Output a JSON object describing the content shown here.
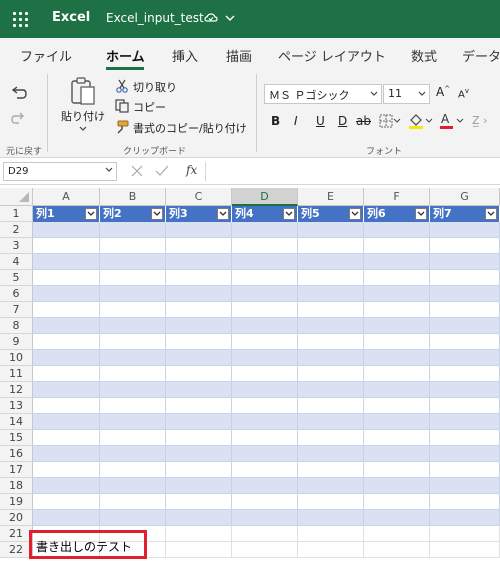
{
  "titlebar": {
    "app": "Excel",
    "document": "Excel_input_test"
  },
  "tabs": [
    "ファイル",
    "ホーム",
    "挿入",
    "描画",
    "ページ レイアウト",
    "数式",
    "データ"
  ],
  "ribbon": {
    "undo_label": "元に戻す",
    "paste_label": "貼り付け",
    "cut_label": "切り取り",
    "copy_label": "コピー",
    "format_painter_label": "書式のコピー/貼り付け",
    "clipboard_group": "クリップボード",
    "font_name": "ＭＳ Ｐゴシック",
    "font_size": "11",
    "font_group": "フォント",
    "bold": "B",
    "italic": "I",
    "underline": "U",
    "double_underline": "D",
    "strikethrough": "ab"
  },
  "formula_bar": {
    "name_box": "D29",
    "fx": "fx"
  },
  "grid": {
    "columns": [
      "A",
      "B",
      "C",
      "D",
      "E",
      "F",
      "G"
    ],
    "selected_column": "D",
    "rows": [
      "1",
      "2",
      "3",
      "4",
      "5",
      "6",
      "7",
      "8",
      "9",
      "10",
      "11",
      "12",
      "13",
      "14",
      "15",
      "16",
      "17",
      "18",
      "19",
      "20",
      "21",
      "22"
    ],
    "table_headers": [
      "列1",
      "列2",
      "列3",
      "列4",
      "列5",
      "列6",
      "列7"
    ],
    "cell_A21": "書き出しのテスト"
  },
  "colors": {
    "title_green": "#1e7145",
    "table_header": "#4472c4",
    "band_light": "#d9e1f2",
    "highlight": "#e0202e"
  }
}
